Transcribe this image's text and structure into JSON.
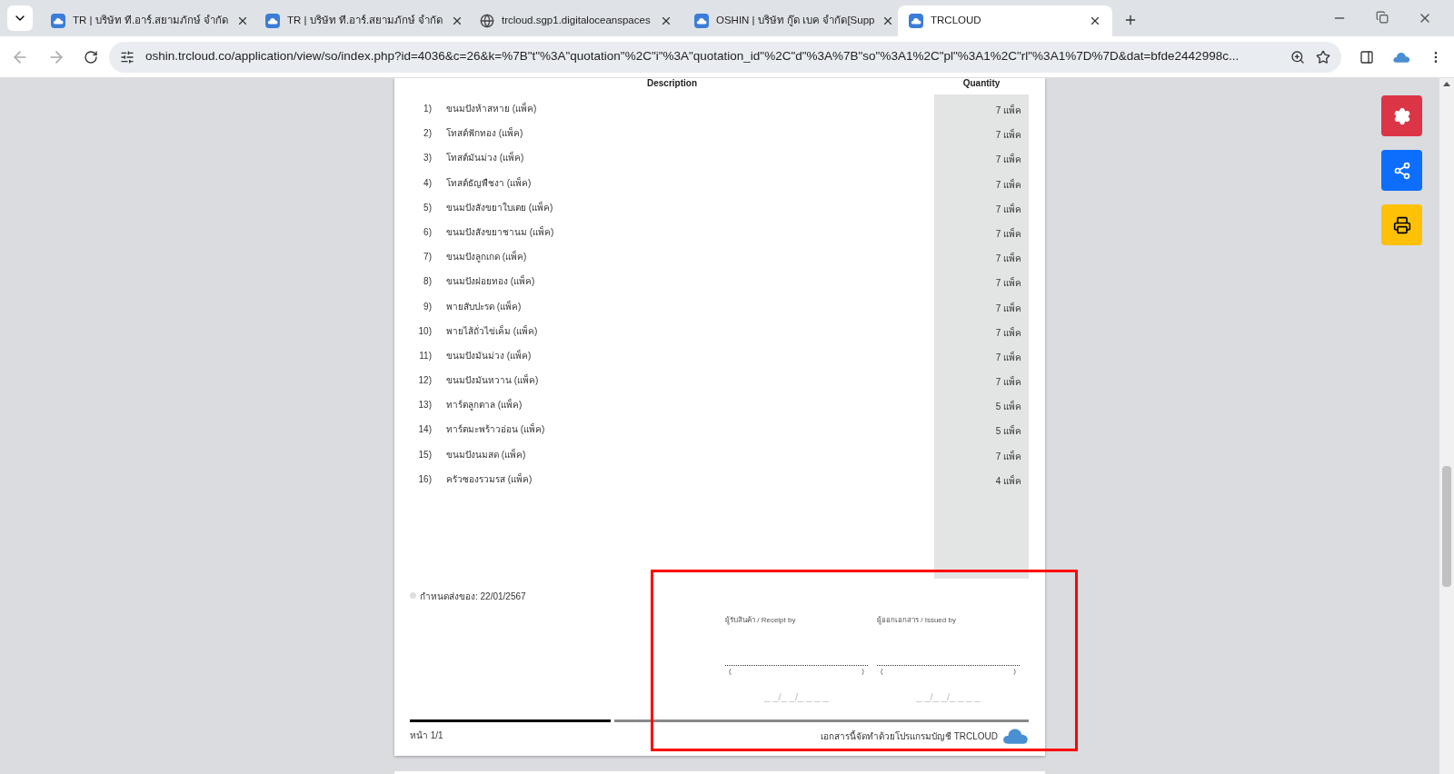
{
  "browser": {
    "tabs": [
      {
        "title": "TR | บริษัท ที.อาร์.สยามภักษ์ จำกัด",
        "kind": "cloud",
        "selected": false
      },
      {
        "title": "TR | บริษัท ที.อาร์.สยามภักษ์ จำกัด",
        "kind": "cloud",
        "selected": false
      },
      {
        "title": "trcloud.sgp1.digitaloceanspaces",
        "kind": "globe",
        "selected": false
      },
      {
        "title": "OSHIN | บริษัท กู๊ด เบค จำกัด[Supp",
        "kind": "cloud",
        "selected": false
      },
      {
        "title": "TRCLOUD",
        "kind": "cloud",
        "selected": true
      }
    ],
    "address": "oshin.trcloud.co/application/view/so/index.php?id=4036&c=26&k=%7B\"t\"%3A\"quotation\"%2C\"i\"%3A\"quotation_id\"%2C\"d\"%3A%7B\"so\"%3A1%2C\"pl\"%3A1%2C\"rl\"%3A1%7D%7D&dat=bfde2442998c..."
  },
  "document": {
    "columns": [
      "Description",
      "Quantity"
    ],
    "items": [
      {
        "number": "1)",
        "description": "ขนมปังห้าสหาย (แพ็ค)",
        "quantity": "7 แพ็ค"
      },
      {
        "number": "2)",
        "description": "โทสต์ฟักทอง (แพ็ค)",
        "quantity": "7 แพ็ค"
      },
      {
        "number": "3)",
        "description": "โทสต์มันม่วง (แพ็ค)",
        "quantity": "7 แพ็ค"
      },
      {
        "number": "4)",
        "description": "โทสต์ธัญพืชงา (แพ็ค)",
        "quantity": "7 แพ็ค"
      },
      {
        "number": "5)",
        "description": "ขนมปังสังขยาใบเตย (แพ็ค)",
        "quantity": "7 แพ็ค"
      },
      {
        "number": "6)",
        "description": "ขนมปังสังขยาชานม (แพ็ค)",
        "quantity": "7 แพ็ค"
      },
      {
        "number": "7)",
        "description": "ขนมปังลูกเกด (แพ็ค)",
        "quantity": "7 แพ็ค"
      },
      {
        "number": "8)",
        "description": "ขนมปังฝอยทอง (แพ็ค)",
        "quantity": "7 แพ็ค"
      },
      {
        "number": "9)",
        "description": "พายสับปะรด (แพ็ค)",
        "quantity": "7 แพ็ค"
      },
      {
        "number": "10)",
        "description": "พายไส้ถั่วไข่เค็ม (แพ็ค)",
        "quantity": "7 แพ็ค"
      },
      {
        "number": "11)",
        "description": "ขนมปังมันม่วง (แพ็ค)",
        "quantity": "7 แพ็ค"
      },
      {
        "number": "12)",
        "description": "ขนมปังมันหวาน (แพ็ค)",
        "quantity": "7 แพ็ค"
      },
      {
        "number": "13)",
        "description": "ทาร์ตลูกตาล (แพ็ค)",
        "quantity": "5 แพ็ค"
      },
      {
        "number": "14)",
        "description": "ทาร์ตมะพร้าวอ่อน (แพ็ค)",
        "quantity": "5 แพ็ค"
      },
      {
        "number": "15)",
        "description": "ขนมปังนมสด (แพ็ค)",
        "quantity": "7 แพ็ค"
      },
      {
        "number": "16)",
        "description": "ครัวซองรวมรส (แพ็ค)",
        "quantity": "4 แพ็ค"
      }
    ],
    "delivery_date": "กำหนดส่งของ: 22/01/2567",
    "signatures": [
      {
        "label": "ผู้รับสินค้า / Receipt by",
        "open_paren": "(",
        "close_paren": ")",
        "date_blank": "_ _/_ _/_ _ _ _"
      },
      {
        "label": "ผู้ออกเอกสาร / Issued by",
        "open_paren": "(",
        "close_paren": ")",
        "date_blank": "_ _/_ _/_ _ _ _"
      }
    ],
    "page_number": "หน้า 1/1",
    "footer": "เอกสารนี้จัดทำด้วยโปรแกรมบัญชี TRCLOUD"
  },
  "actions": [
    {
      "kind": "settings"
    },
    {
      "kind": "share"
    },
    {
      "kind": "print"
    }
  ]
}
